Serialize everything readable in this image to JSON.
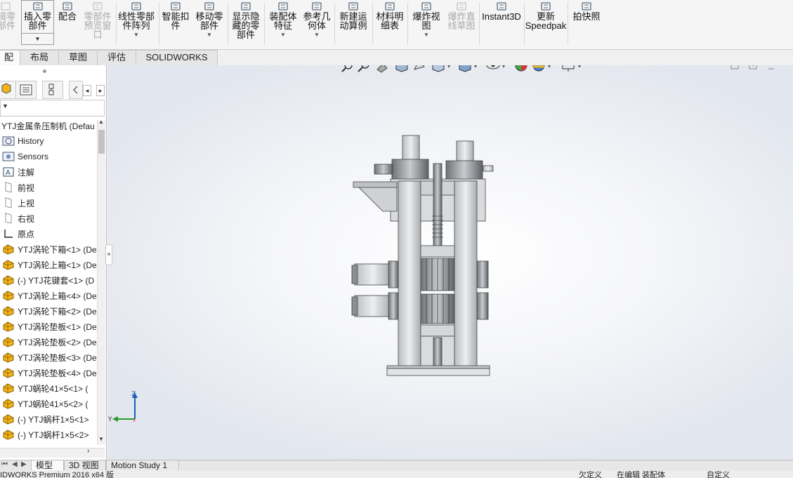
{
  "ribbon": {
    "buttons": [
      {
        "label": "插入零\n部件",
        "icon": "insert-component-icon"
      },
      {
        "label": "配合",
        "icon": "mate-icon"
      },
      {
        "label": "零部件\n预览窗\n口",
        "icon": "component-preview-icon"
      },
      {
        "label": "线性零部\n件阵列",
        "icon": "linear-pattern-icon"
      },
      {
        "label": "智能扣\n件",
        "icon": "smart-fasteners-icon"
      },
      {
        "label": "移动零\n部件",
        "icon": "move-component-icon"
      },
      {
        "label": "显示隐\n藏的零\n部件",
        "icon": "show-hidden-icon"
      },
      {
        "label": "装配体\n特征",
        "icon": "assembly-feature-icon"
      },
      {
        "label": "参考几\n何体",
        "icon": "reference-geometry-icon"
      },
      {
        "label": "新建运\n动算例",
        "icon": "new-motion-study-icon"
      },
      {
        "label": "材料明\n细表",
        "icon": "bom-icon"
      },
      {
        "label": "爆炸视\n图",
        "icon": "exploded-view-icon"
      },
      {
        "label": "爆炸直\n线草图",
        "icon": "explode-line-sketch-icon"
      },
      {
        "label": "Instant3D",
        "icon": "instant3d-icon"
      },
      {
        "label": "更新\nSpeedpak",
        "icon": "speedpak-icon"
      },
      {
        "label": "拍快照",
        "icon": "snapshot-icon"
      }
    ],
    "cut_label": "辑零\n部件"
  },
  "tabs": [
    "配体",
    "布局",
    "草图",
    "评估",
    "SOLIDWORKS 插件"
  ],
  "tree": {
    "root": "YTJ金属条压制机 (Defau",
    "items": [
      {
        "label": "History",
        "icon": "history-icon"
      },
      {
        "label": "Sensors",
        "icon": "sensors-icon"
      },
      {
        "label": "注解",
        "icon": "annotations-icon"
      },
      {
        "label": "前视",
        "icon": "plane-icon"
      },
      {
        "label": "上视",
        "icon": "plane-icon"
      },
      {
        "label": "右视",
        "icon": "plane-icon"
      },
      {
        "label": "原点",
        "icon": "origin-icon"
      },
      {
        "label": "YTJ涡轮下箱<1> (De",
        "icon": "part-icon"
      },
      {
        "label": "YTJ涡轮上箱<1> (De",
        "icon": "part-icon"
      },
      {
        "label": "(-) YTJ花键套<1> (D",
        "icon": "part-icon"
      },
      {
        "label": "YTJ涡轮上箱<4> (De",
        "icon": "part-icon"
      },
      {
        "label": "YTJ涡轮下箱<2> (De",
        "icon": "part-icon"
      },
      {
        "label": "YTJ涡轮垫板<1> (De",
        "icon": "part-icon"
      },
      {
        "label": "YTJ涡轮垫板<2> (De",
        "icon": "part-icon"
      },
      {
        "label": "YTJ涡轮垫板<3> (De",
        "icon": "part-icon"
      },
      {
        "label": "YTJ涡轮垫板<4> (De",
        "icon": "part-icon"
      },
      {
        "label": "YTJ蜗轮41×5<1> (",
        "icon": "part-icon"
      },
      {
        "label": "YTJ蜗轮41×5<2> (",
        "icon": "part-icon"
      },
      {
        "label": "(-) YTJ蜗杆1×5<1>",
        "icon": "part-icon"
      },
      {
        "label": "(-) YTJ蜗杆1×5<2>",
        "icon": "part-icon"
      }
    ]
  },
  "triad": {
    "z": "Z",
    "y": "Y",
    "x": "X"
  },
  "bottom_tabs": [
    "模型",
    "3D 视图",
    "Motion Study 1"
  ],
  "status": {
    "left": "IDWORKS Premium 2016 x64 版",
    "under_defined": "欠定义",
    "editing": "在编辑 装配体",
    "custom": "自定义"
  },
  "colors": {
    "accent_blue": "#1a5fb4",
    "ribbon_bg": "#f5f5f5",
    "part_yellow": "#f2b21b"
  }
}
